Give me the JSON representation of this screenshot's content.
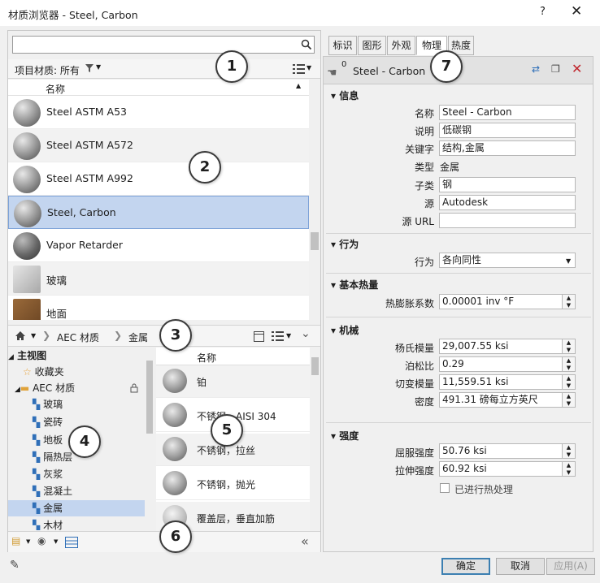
{
  "window": {
    "title": "材质浏览器 - Steel, Carbon",
    "help": "?",
    "close": "✕"
  },
  "search": {
    "value": "",
    "placeholder": ""
  },
  "filter": {
    "label": "项目材质: 所有"
  },
  "list": {
    "header": "名称",
    "items": [
      {
        "label": "Steel ASTM A53"
      },
      {
        "label": "Steel ASTM A572"
      },
      {
        "label": "Steel ASTM A992"
      },
      {
        "label": "Steel, Carbon"
      },
      {
        "label": "Vapor Retarder"
      },
      {
        "label": "玻璃"
      },
      {
        "label": "地面"
      }
    ]
  },
  "breadcrumb": {
    "items": [
      "AEC 材质",
      "金属"
    ]
  },
  "tree": {
    "root": "主视图",
    "favorites": "收藏夹",
    "aec": "AEC 材质",
    "children": [
      "玻璃",
      "瓷砖",
      "地板",
      "隔热层",
      "灰浆",
      "混凝土",
      "金属",
      "木材"
    ],
    "selected": "金属"
  },
  "grid": {
    "header": "名称",
    "items": [
      "铂",
      "不锈钢，AISI 304",
      "不锈钢，拉丝",
      "不锈钢，抛光",
      "覆盖层，垂直加筋"
    ]
  },
  "tabs": [
    {
      "label": "标识"
    },
    {
      "label": "图形"
    },
    {
      "label": "外观"
    },
    {
      "label": "物理"
    },
    {
      "label": "热度"
    }
  ],
  "active_tab": "物理",
  "asset": {
    "name": "Steel - Carbon",
    "count": "0"
  },
  "sections": {
    "info": "信息",
    "behavior": "行为",
    "thermal": "基本热量",
    "mechanical": "机械",
    "strength": "强度"
  },
  "info": {
    "name_label": "名称",
    "name_value": "Steel - Carbon",
    "desc_label": "说明",
    "desc_value": "低碳钢",
    "keywords_label": "关键字",
    "keywords_value": "结构,金属",
    "type_label": "类型",
    "type_value": "金属",
    "subclass_label": "子类",
    "subclass_value": "钢",
    "source_label": "源",
    "source_value": "Autodesk",
    "url_label": "源 URL",
    "url_value": ""
  },
  "behavior": {
    "label": "行为",
    "value": "各向同性"
  },
  "thermal": {
    "label": "热膨胀系数",
    "value": "0.00001 inv °F"
  },
  "mechanical": {
    "youngs_label": "杨氏模量",
    "youngs_value": "29,007.55 ksi",
    "poisson_label": "泊松比",
    "poisson_value": "0.29",
    "shear_label": "切变模量",
    "shear_value": "11,559.51 ksi",
    "density_label": "密度",
    "density_value": "491.31 磅每立方英尺"
  },
  "strength": {
    "yield_label": "屈服强度",
    "yield_value": "50.76 ksi",
    "tensile_label": "拉伸强度",
    "tensile_value": "60.92 ksi",
    "heat_label": "已进行热处理",
    "heat_checked": false
  },
  "buttons": {
    "ok": "确定",
    "cancel": "取消",
    "apply": "应用(A)"
  },
  "callouts": [
    "1",
    "2",
    "3",
    "4",
    "5",
    "6",
    "7"
  ]
}
